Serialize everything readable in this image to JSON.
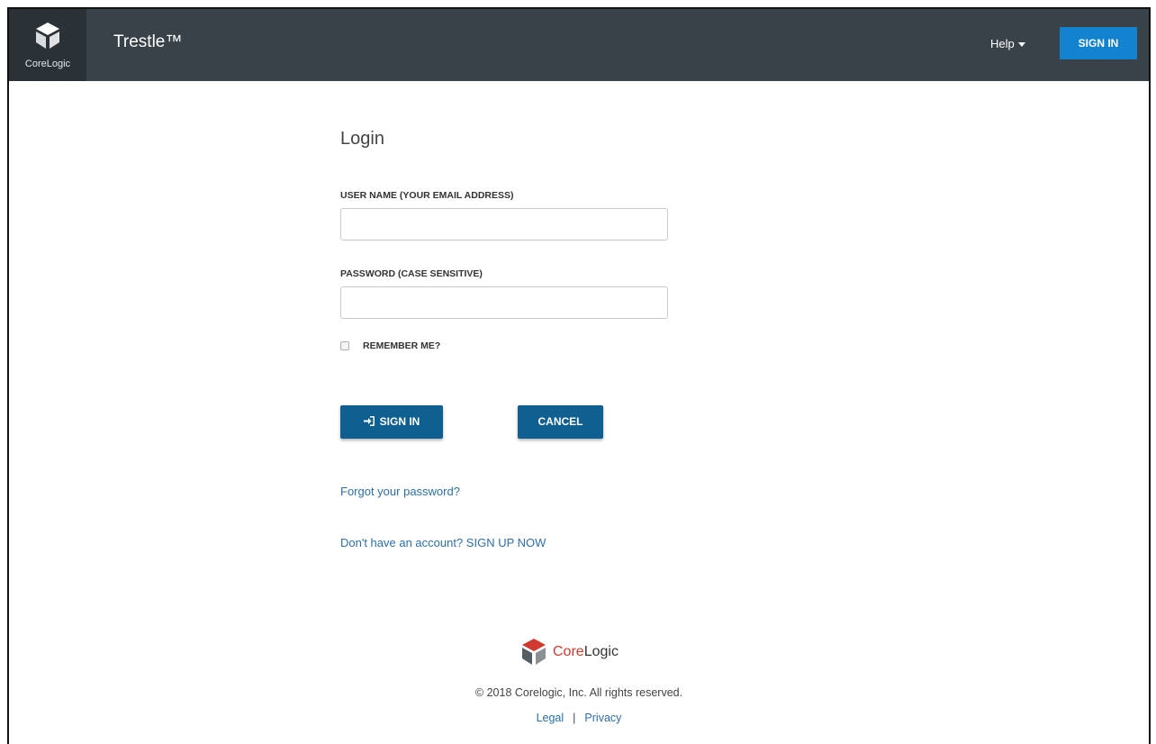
{
  "header": {
    "brand_text": "CoreLogic",
    "app_title": "Trestle™",
    "help_label": "Help",
    "signin_label": "SIGN IN"
  },
  "login": {
    "title": "Login",
    "username_label": "USER NAME (YOUR EMAIL ADDRESS)",
    "username_value": "",
    "password_label": "PASSWORD (CASE SENSITIVE)",
    "password_value": "",
    "remember_label": "REMEMBER ME?",
    "remember_checked": false,
    "signin_button": "SIGN IN",
    "cancel_button": "CANCEL",
    "forgot_link": "Forgot your password?",
    "signup_link": "Don't have an account? SIGN UP NOW"
  },
  "footer": {
    "logo_core": "Core",
    "logo_logic": "Logic",
    "copyright": "© 2018 Corelogic, Inc. All rights reserved.",
    "legal_link": "Legal",
    "separator": "|",
    "privacy_link": "Privacy"
  },
  "colors": {
    "header_bg": "#394249",
    "brand_box_bg": "#2b3237",
    "top_signin_bg": "#1483cf",
    "button_bg": "#0f5f91",
    "link": "#2d6fa8",
    "logo_red": "#d13b2f"
  },
  "icons": {
    "brand": "corelogic-cube-icon",
    "help_caret": "caret-down-icon",
    "signin": "sign-in-icon",
    "footer_logo": "corelogic-logo-icon"
  }
}
